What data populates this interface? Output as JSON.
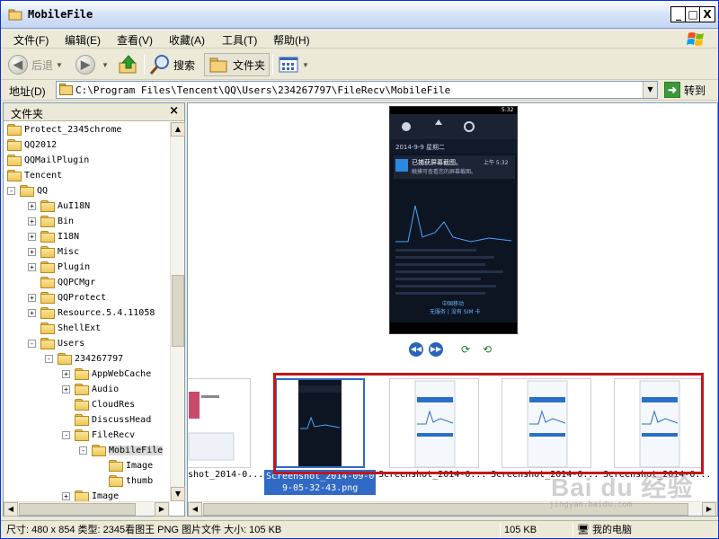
{
  "window": {
    "title": "MobileFile",
    "min": "_",
    "max": "□",
    "close": "X"
  },
  "menu": [
    "文件(F)",
    "编辑(E)",
    "查看(V)",
    "收藏(A)",
    "工具(T)",
    "帮助(H)"
  ],
  "toolbar": {
    "back": "后退",
    "search": "搜索",
    "folders": "文件夹"
  },
  "address": {
    "label": "地址(D)",
    "path": "C:\\Program Files\\Tencent\\QQ\\Users\\234267797\\FileRecv\\MobileFile",
    "go": "转到"
  },
  "folder_pane": {
    "title": "文件夹",
    "close": "×",
    "items": [
      {
        "label": "Protect_2345chrome",
        "expander": ""
      },
      {
        "label": "QQ2012",
        "expander": ""
      },
      {
        "label": "QQMailPlugin",
        "expander": ""
      },
      {
        "label": "Tencent",
        "expander": ""
      },
      {
        "label": "QQ",
        "expander": "-"
      },
      {
        "label": "AuI18N",
        "expander": "+"
      },
      {
        "label": "Bin",
        "expander": "+"
      },
      {
        "label": "I18N",
        "expander": "+"
      },
      {
        "label": "Misc",
        "expander": "+"
      },
      {
        "label": "Plugin",
        "expander": "+"
      },
      {
        "label": "QQPCMgr",
        "expander": ""
      },
      {
        "label": "QQProtect",
        "expander": "+"
      },
      {
        "label": "Resource.5.4.11058",
        "expander": "+"
      },
      {
        "label": "ShellExt",
        "expander": ""
      },
      {
        "label": "Users",
        "expander": "-"
      },
      {
        "label": "234267797",
        "expander": "-"
      },
      {
        "label": "AppWebCache",
        "expander": "+"
      },
      {
        "label": "Audio",
        "expander": "+"
      },
      {
        "label": "CloudRes",
        "expander": ""
      },
      {
        "label": "DiscussHead",
        "expander": ""
      },
      {
        "label": "FileRecv",
        "expander": "-"
      },
      {
        "label": "MobileFile",
        "expander": "-"
      },
      {
        "label": "Image",
        "expander": ""
      },
      {
        "label": "thumb",
        "expander": ""
      },
      {
        "label": "Image",
        "expander": "+"
      }
    ]
  },
  "preview": {
    "date": "2014-9-9 星期二",
    "notif_title": "已捕获屏幕截图。",
    "notif_body": "触摸可查看您的屏幕截图。",
    "notif_time": "上午 5:32",
    "carrier": "中国移动",
    "carrier2": "无服务 | 没有 SIM 卡",
    "status_time": "5:32"
  },
  "thumbnails": [
    {
      "caption": "shot_2014-0...",
      "selected": false
    },
    {
      "caption": "Screenshot_2014-09-09-05-32-43.png",
      "caption_line1": "Screenshot_2014-09-0",
      "caption_line2": "9-05-32-43.png",
      "selected": true
    },
    {
      "caption": "Screenshot_2014-0...",
      "selected": false
    },
    {
      "caption": "Screenshot_2014-0...",
      "selected": false
    },
    {
      "caption": "Screenshot_2014-0...",
      "selected": false
    }
  ],
  "status": {
    "info": "尺寸: 480 x 854 类型: 2345看图王 PNG 图片文件 大小: 105 KB",
    "size": "105 KB",
    "location": "我的电脑"
  },
  "watermark": {
    "logo": "Bai du 经验",
    "url": "jingyan.baidu.com"
  },
  "colors": {
    "title_gradient": "#d8e4f8",
    "selection": "#316ac5",
    "highlight_box": "#c0171c",
    "face": "#ece9d8"
  }
}
